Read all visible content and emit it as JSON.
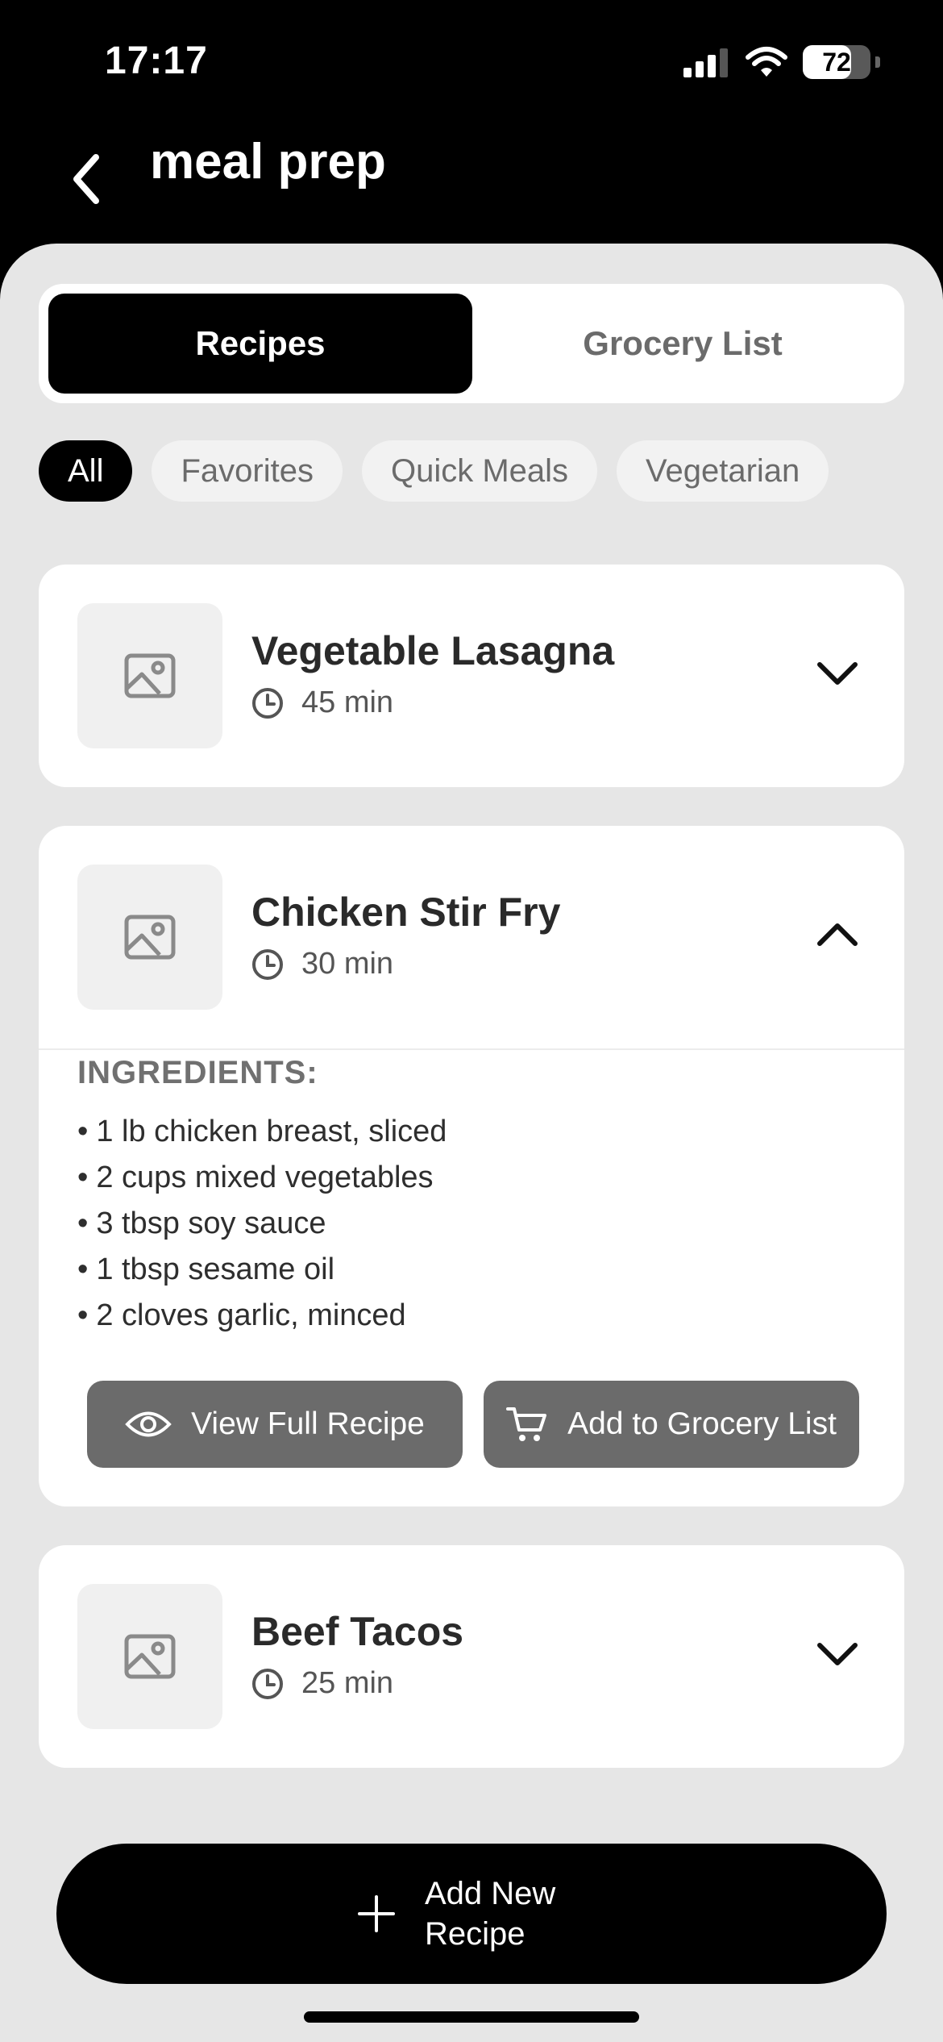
{
  "status_bar": {
    "time": "17:17",
    "battery": "72",
    "battery_level": 0.72
  },
  "header": {
    "title": "meal prep"
  },
  "segments": {
    "active": "Recipes",
    "inactive": "Grocery List"
  },
  "filters": [
    "All",
    "Favorites",
    "Quick Meals",
    "Vegetarian"
  ],
  "recipes": [
    {
      "name": "Vegetable Lasagna",
      "time": "45 min",
      "expanded": false
    },
    {
      "name": "Chicken Stir Fry",
      "time": "30 min",
      "expanded": true,
      "ingredients_title": "INGREDIENTS:",
      "ingredients": [
        "1 lb chicken breast, sliced",
        "2 cups mixed vegetables",
        "3 tbsp soy sauce",
        "1 tbsp sesame oil",
        "2 cloves garlic, minced"
      ],
      "view_label": "View Full Recipe",
      "add_label": "Add to Grocery List"
    },
    {
      "name": "Beef Tacos",
      "time": "25 min",
      "expanded": false
    }
  ],
  "fab": {
    "label": "Add New Recipe"
  },
  "icons": {
    "back": "chevron-left-icon",
    "image": "image-placeholder-icon",
    "clock": "clock-icon",
    "expand": "chevron-down-icon",
    "collapse": "chevron-up-icon",
    "eye": "eye-icon",
    "cart": "cart-icon",
    "plus": "plus-icon"
  },
  "colors": {
    "accent": "#000000",
    "sheet": "#e6e6e6",
    "action_button": "#6b6b6b"
  }
}
